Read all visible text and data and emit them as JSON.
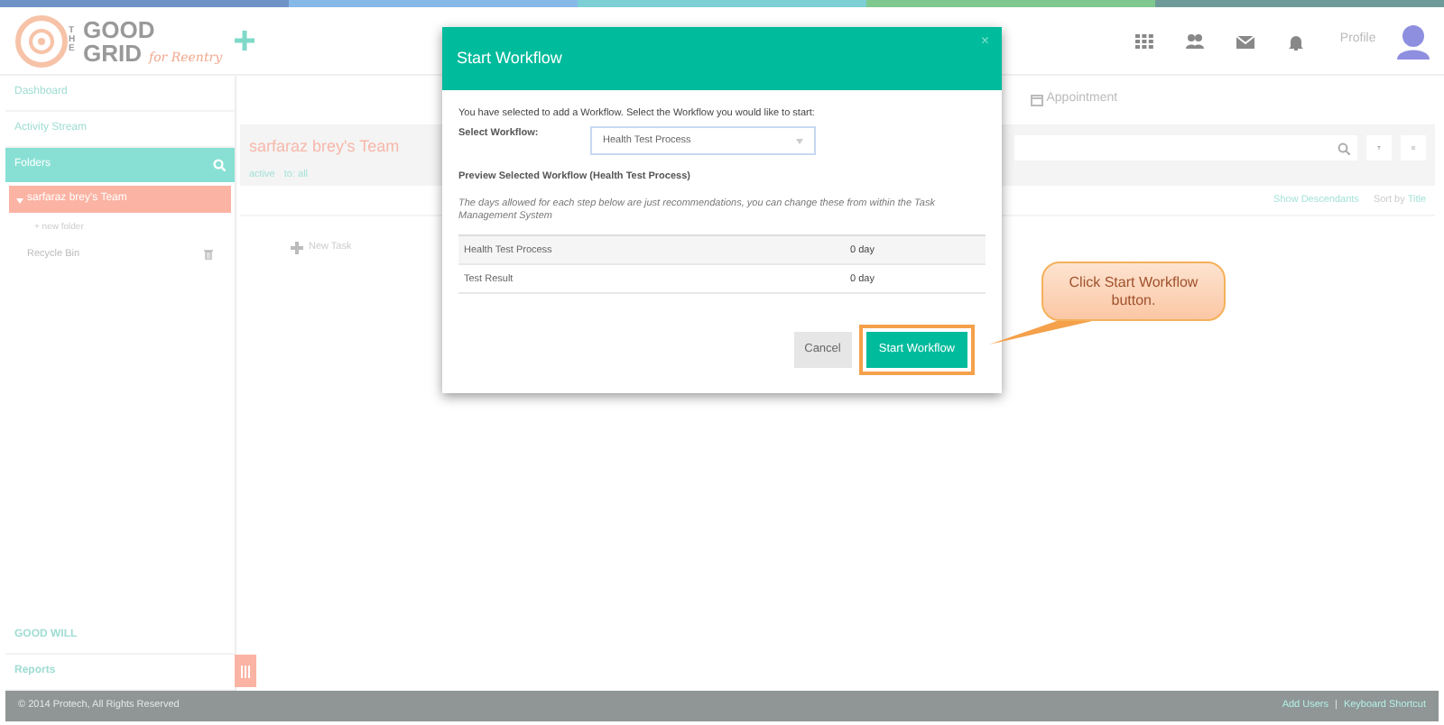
{
  "logo": {
    "prefix": "THE",
    "word_1": "GOOD",
    "word_2": "GRID",
    "tagline": "for Reentry"
  },
  "header": {
    "profile": "Profile"
  },
  "sidebar": {
    "items_top": [
      {
        "label": "Dashboard"
      },
      {
        "label": "Activity Stream"
      }
    ],
    "folders": {
      "label": "Folders"
    },
    "tree": [
      {
        "label": "sarfaraz brey's Team",
        "selected": true,
        "expanded": true
      }
    ],
    "new_folder": "+ new folder",
    "recycle_bin": "Recycle Bin",
    "items_bottom": [
      {
        "label": "GOOD WILL"
      },
      {
        "label": "Reports"
      }
    ]
  },
  "main": {
    "tabs": [
      {
        "label": "Appointment"
      }
    ],
    "team": {
      "title": "sarfaraz brey's Team",
      "filters": [
        "active",
        "to: all"
      ]
    },
    "show_descendants": "Show Descendants",
    "sort_by": "Sort by",
    "sort_field": "Title",
    "new_task": "New Task"
  },
  "modal": {
    "title": "Start Workflow",
    "close": "×",
    "intro": "You have selected to add a Workflow. Select the Workflow you would like to start:",
    "select_label": "Select Workflow:",
    "select_value": "Health Test Process",
    "preview_heading": "Preview Selected Workflow (Health Test Process)",
    "note": "The days allowed for each step below are just recommendations, you can change these from within the Task Management System",
    "steps": [
      {
        "name": "Health Test Process",
        "duration": "0 day"
      },
      {
        "name": "Test Result",
        "duration": "0 day"
      }
    ],
    "cancel": "Cancel",
    "start": {
      "label": "Start Workflow",
      "highlighted": true
    }
  },
  "callout": {
    "text": "Click Start Workflow button."
  },
  "footer": {
    "copyright": "© 2014 Protech, All Rights Reserved",
    "links": [
      "Add Users",
      "Keyboard Shortcut"
    ],
    "separator": "|"
  }
}
